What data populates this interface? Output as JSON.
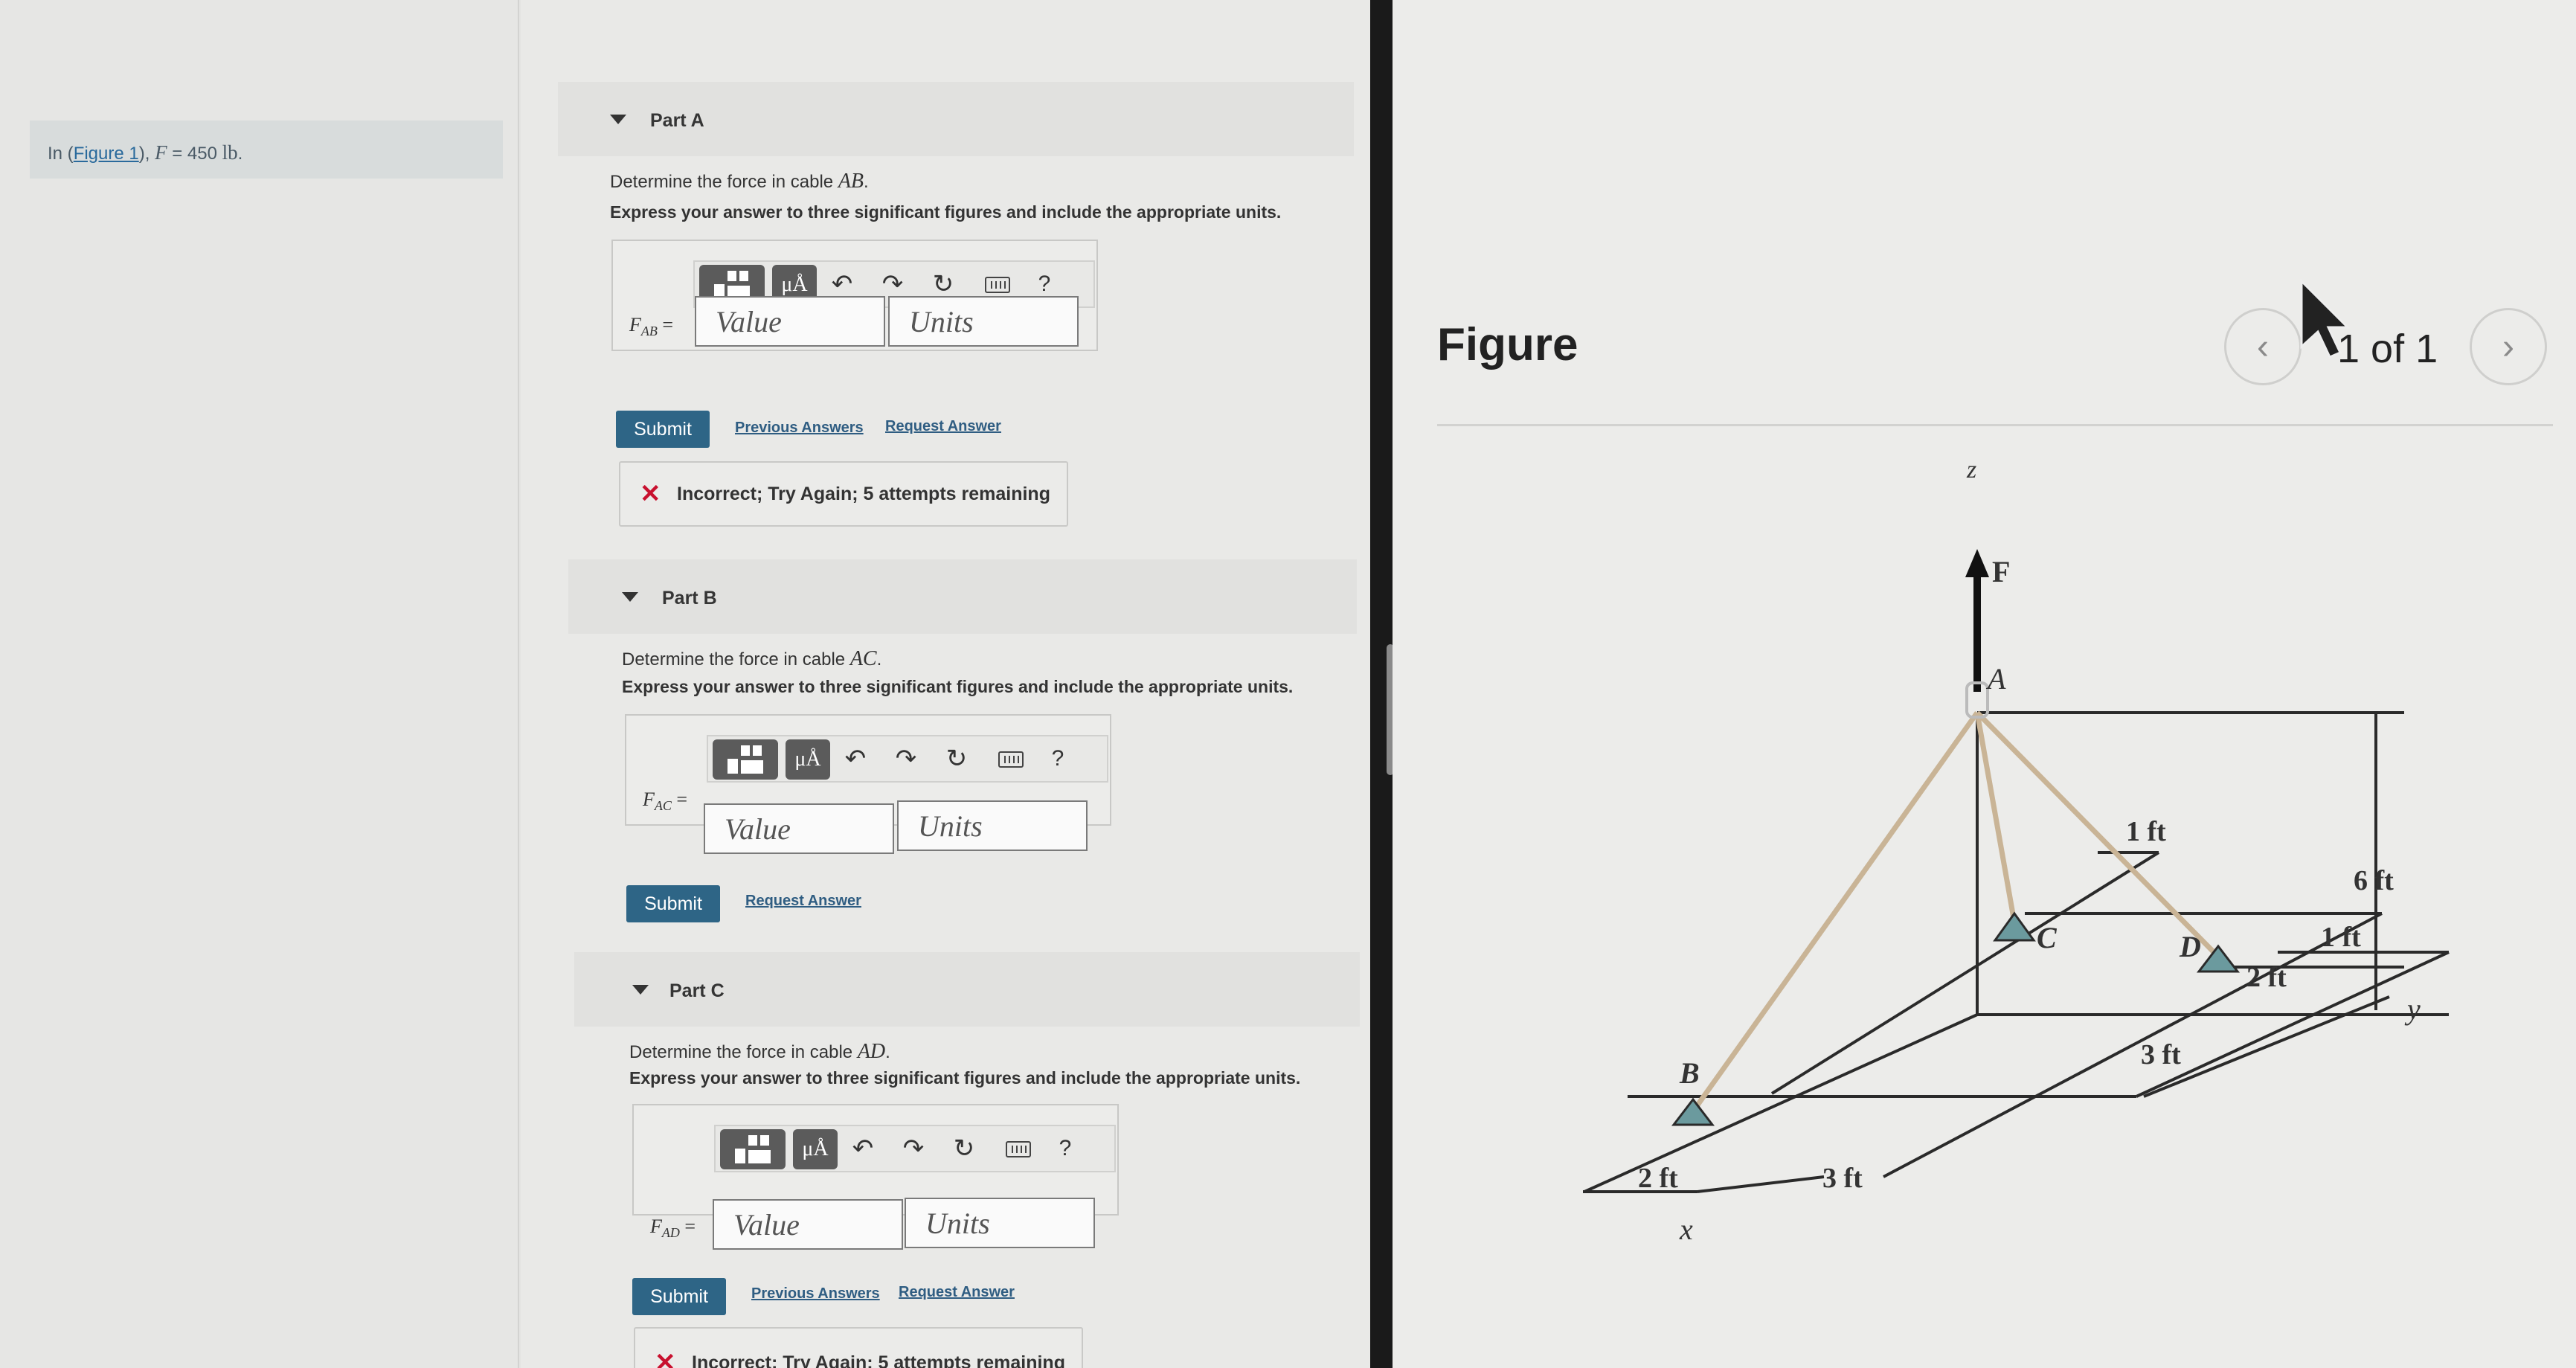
{
  "intro": {
    "prefix": "In (",
    "figure_link": "Figure 1",
    "suffix": "), ",
    "var": "F",
    "eq": " = 450 ",
    "unit": "lb",
    "end": "."
  },
  "toolbar": {
    "units_btn": "μÅ",
    "undo": "↶",
    "redo": "↷",
    "reset": "↻",
    "help": "?",
    "icons": [
      "templates-icon",
      "units-icon",
      "undo-icon",
      "redo-icon",
      "reset-icon",
      "keyboard-icon",
      "help-icon"
    ]
  },
  "parts": [
    {
      "title": "Part A",
      "question_prefix": "Determine the force in cable ",
      "cable": "AB",
      "question_suffix": ".",
      "instruction": "Express your answer to three significant figures and include the appropriate units.",
      "var": "F",
      "sub": "AB",
      "eq": " =",
      "value_placeholder": "Value",
      "units_placeholder": "Units",
      "submit": "Submit",
      "previous_answers": "Previous Answers",
      "request_answer": "Request Answer",
      "feedback": "Incorrect; Try Again; 5 attempts remaining"
    },
    {
      "title": "Part B",
      "question_prefix": "Determine the force in cable ",
      "cable": "AC",
      "question_suffix": ".",
      "instruction": "Express your answer to three significant figures and include the appropriate units.",
      "var": "F",
      "sub": "AC",
      "eq": " =",
      "value_placeholder": "Value",
      "units_placeholder": "Units",
      "submit": "Submit",
      "request_answer": "Request Answer"
    },
    {
      "title": "Part C",
      "question_prefix": "Determine the force in cable ",
      "cable": "AD",
      "question_suffix": ".",
      "instruction": "Express your answer to three significant figures and include the appropriate units.",
      "var": "F",
      "sub": "AD",
      "eq": " =",
      "value_placeholder": "Value",
      "units_placeholder": "Units",
      "submit": "Submit",
      "previous_answers": "Previous Answers",
      "request_answer": "Request Answer",
      "feedback": "Incorrect; Try Again; 5 attempts remaining"
    }
  ],
  "figure": {
    "title": "Figure",
    "prev": "‹",
    "next": "›",
    "page_indicator": "1 of 1",
    "labels": {
      "z": "z",
      "F": "F",
      "A": "A",
      "B": "B",
      "C": "C",
      "D": "D",
      "x": "x",
      "y": "y",
      "d_1ft_top": "1 ft",
      "d_6ft": "6 ft",
      "d_1ft_right": "1 ft",
      "d_2ft_right": "2 ft",
      "d_3ft_right": "3 ft",
      "d_2ft_left": "2 ft",
      "d_3ft_bottom": "3 ft"
    }
  },
  "colors": {
    "submit": "#2e6586",
    "link": "#2f5d82",
    "error": "#c8102e",
    "cable": "#c9b496",
    "support": "#6b9a9e"
  }
}
